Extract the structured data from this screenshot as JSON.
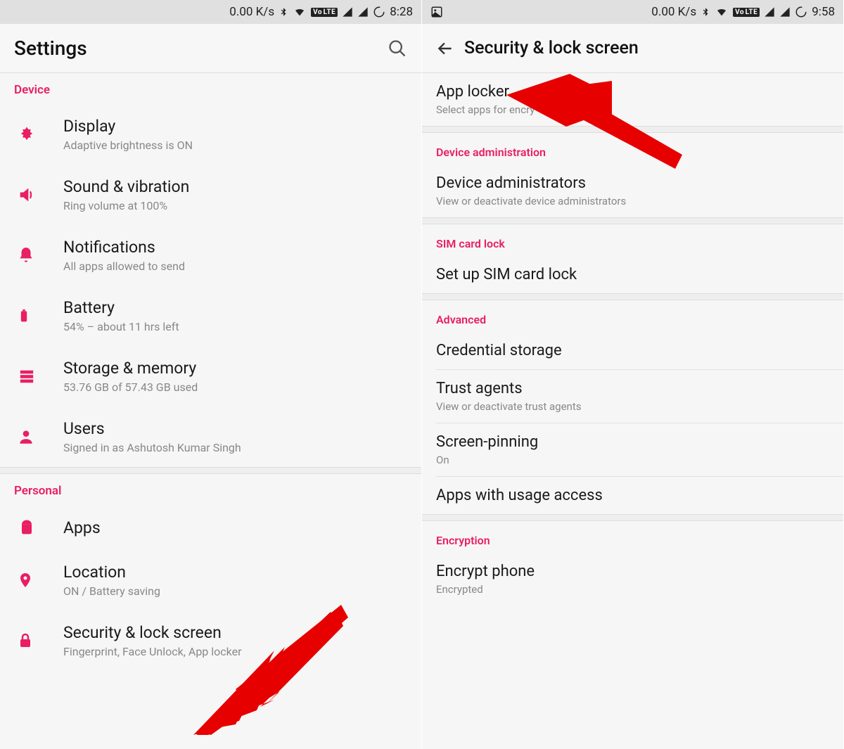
{
  "left": {
    "status": {
      "speed": "0.00 K/s",
      "time": "8:28"
    },
    "appbar": {
      "title": "Settings"
    },
    "sections": {
      "device": "Device",
      "personal": "Personal"
    },
    "items": {
      "display": {
        "title": "Display",
        "sub": "Adaptive brightness is ON"
      },
      "sound": {
        "title": "Sound & vibration",
        "sub": "Ring volume at 100%"
      },
      "notif": {
        "title": "Notifications",
        "sub": "All apps allowed to send"
      },
      "battery": {
        "title": "Battery",
        "sub": "54% – about 11 hrs left"
      },
      "storage": {
        "title": "Storage & memory",
        "sub": "53.76 GB of 57.43 GB used"
      },
      "users": {
        "title": "Users",
        "sub": "Signed in as Ashutosh Kumar Singh"
      },
      "apps": {
        "title": "Apps"
      },
      "location": {
        "title": "Location",
        "sub": "ON / Battery saving"
      },
      "security": {
        "title": "Security & lock screen",
        "sub": "Fingerprint, Face Unlock, App locker"
      }
    }
  },
  "right": {
    "status": {
      "speed": "0.00 K/s",
      "time": "9:58"
    },
    "appbar": {
      "title": "Security & lock screen"
    },
    "sections": {
      "device_admin": "Device administration",
      "sim": "SIM card lock",
      "advanced": "Advanced",
      "encryption": "Encryption"
    },
    "items": {
      "app_locker": {
        "title": "App locker",
        "sub": "Select apps for encry"
      },
      "device_admins": {
        "title": "Device administrators",
        "sub": "View or deactivate device administrators"
      },
      "sim_lock": {
        "title": "Set up SIM card lock"
      },
      "cred_storage": {
        "title": "Credential storage"
      },
      "trust_agents": {
        "title": "Trust agents",
        "sub": "View or deactivate trust agents"
      },
      "screen_pin": {
        "title": "Screen-pinning",
        "sub": "On"
      },
      "usage_access": {
        "title": "Apps with usage access"
      },
      "encrypt_phone": {
        "title": "Encrypt phone",
        "sub": "Encrypted"
      }
    }
  }
}
